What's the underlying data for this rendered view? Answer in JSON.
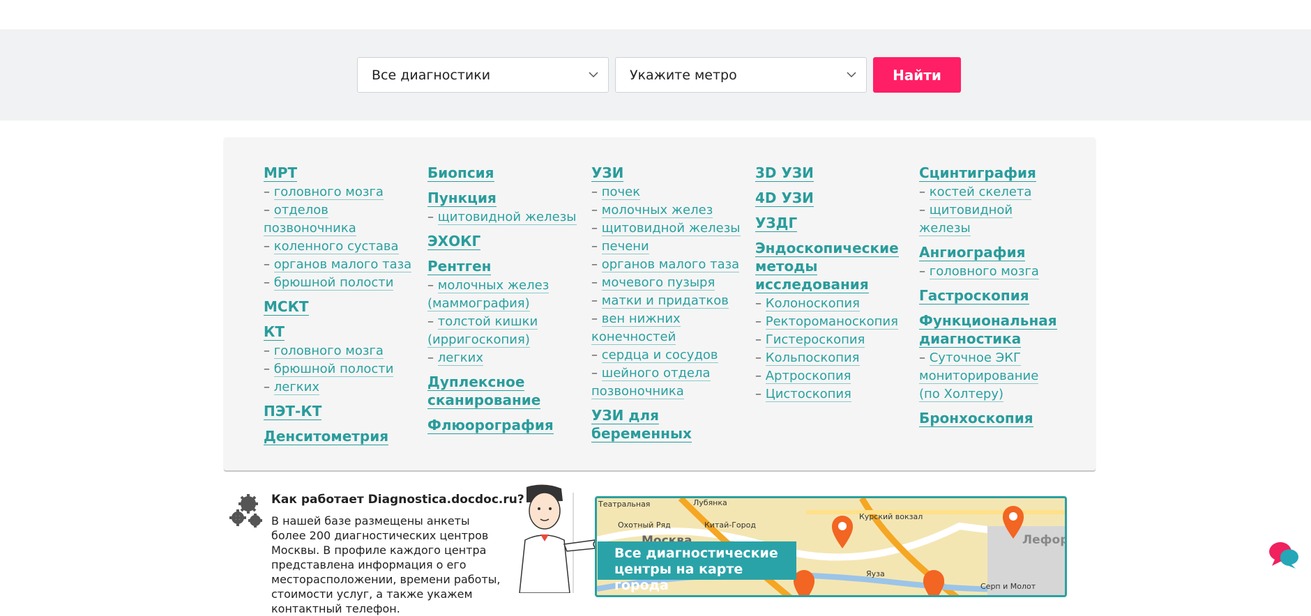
{
  "search": {
    "diagnostics_select": "Все диагностики",
    "metro_select": "Укажите метро",
    "find_button": "Найти"
  },
  "categories": {
    "col1": {
      "mrt": "МРТ",
      "mrt_subs": [
        "головного мозга",
        "отделов позвоночника",
        "коленного сустава",
        "органов малого таза",
        "брюшной полости"
      ],
      "msct": "МСКТ",
      "kt": "КТ",
      "kt_subs": [
        "головного мозга",
        "брюшной полости",
        "легких"
      ],
      "pet_kt": "ПЭТ-КТ",
      "densitometry": "Денситометрия"
    },
    "col2": {
      "biopsy": "Биопсия",
      "puncture": "Пункция",
      "puncture_subs": [
        "щитовидной железы"
      ],
      "echo": "ЭХОКГ",
      "xray": "Рентген",
      "xray_subs": [
        "молочных желез (маммография)",
        "толстой кишки (ирригоскопия)",
        "легких"
      ],
      "duplex": "Дуплексное сканирование",
      "fluoro": "Флюорография"
    },
    "col3": {
      "uzi": "УЗИ",
      "uzi_subs": [
        "почек",
        "молочных желез",
        "щитовидной железы",
        "печени",
        "органов малого таза",
        "мочевого пузыря",
        "матки и придатков",
        "вен нижних конечностей",
        "сердца и сосудов",
        "шейного отдела позвоночника"
      ],
      "uzi_pregnant": "УЗИ для беременных"
    },
    "col4": {
      "uzi3d": "3D УЗИ",
      "uzi4d": "4D УЗИ",
      "uzdg": "УЗДГ",
      "endoscopy": "Эндоскопические методы исследования",
      "endoscopy_subs": [
        "Колоноскопия",
        "Ректороманоскопия",
        "Гистероскопия",
        "Кольпоскопия",
        "Артроскопия",
        "Цистоскопия"
      ]
    },
    "col5": {
      "scint": "Сцинтиграфия",
      "scint_subs": [
        "костей скелета",
        "щитовидной железы"
      ],
      "angio": "Ангиография",
      "angio_subs": [
        "головного мозга"
      ],
      "gastro": "Гастроскопия",
      "func": "Функциональная диагностика",
      "func_subs": [
        "Суточное ЭКГ мониторирование (по Холтеру)"
      ],
      "broncho": "Бронхоскопия"
    }
  },
  "how_it_works": {
    "title": "Как работает Diagnostica.docdoc.ru?",
    "text": "В нашей базе размещены анкеты более 200 диагностических центров Москвы. В профиле каждого центра представлена информация о его месторасположении, времени работы, стоимости услуг, а также укажем контактный телефон."
  },
  "map": {
    "banner": "Все диагностические центры на карте города",
    "labels": [
      "Театральная",
      "Лубянка",
      "Курский вокзал",
      "Охотный Ряд",
      "Китай-Город",
      "Москва",
      "Лефор",
      "Яуза",
      "Серп и Молот"
    ]
  },
  "colors": {
    "accent": "#ff1f66",
    "link": "#2a9c9c",
    "band": "#f1f2f3",
    "panel": "#f5f5f5"
  }
}
